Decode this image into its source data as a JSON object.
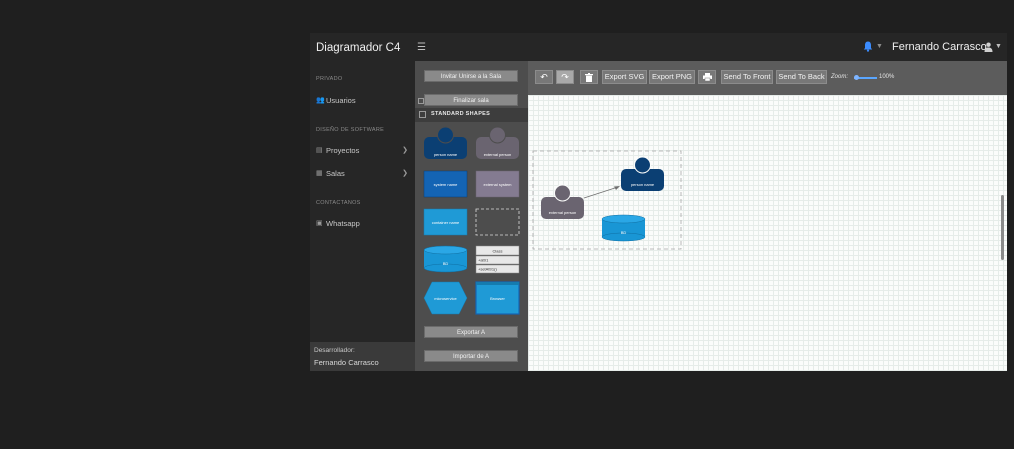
{
  "header": {
    "title": "Diagramador C4",
    "menu_icon": "hamburger-icon",
    "user_name": "Fernando Carrasco",
    "notification_icon": "bell-icon",
    "notification_color": "#3b8cff"
  },
  "sidebar": {
    "sections": [
      {
        "title": "PRIVADO",
        "items": [
          {
            "label": "Usuarios",
            "icon": "users-icon"
          }
        ]
      },
      {
        "title": "DISEÑO DE SOFTWARE",
        "items": [
          {
            "label": "Proyectos",
            "icon": "folder-icon",
            "expandable": true
          },
          {
            "label": "Salas",
            "icon": "rooms-icon",
            "expandable": true
          }
        ]
      },
      {
        "title": "CONTACTANOS",
        "items": [
          {
            "label": "Whatsapp",
            "icon": "whatsapp-icon"
          }
        ]
      }
    ],
    "developer_label": "Desarrollador:",
    "developer_name": "Fernando Carrasco"
  },
  "palette": {
    "invite_button": "Invitar Unirse a la Sala",
    "finish_button": "Finalizar sala",
    "shapes_header": "STANDARD SHAPES",
    "shapes": {
      "person": "person name",
      "external_person": "external person",
      "system": "system name",
      "external_system": "external system",
      "container": "container name",
      "database": "BD",
      "class_title": "Class",
      "class_attr": "+attr1",
      "class_method": "+setAttr1()",
      "microservice": "microservice",
      "browser": "Browser"
    },
    "export_button": "Exportar A",
    "import_button": "Importar de A",
    "colors": {
      "person": "#0b3f73",
      "external": "#6a6470",
      "system": "#1464b4",
      "container": "#1f9ad6",
      "database": "#1996d5"
    }
  },
  "toolbar": {
    "undo_icon": "undo-icon",
    "redo_icon": "redo-icon",
    "delete_icon": "trash-icon",
    "export_svg": "Export SVG",
    "export_png": "Export PNG",
    "print_icon": "print-icon",
    "send_front": "Send To Front",
    "send_back": "Send To Back",
    "zoom_label": "Zoom:",
    "zoom_value": "100%"
  },
  "canvas": {
    "nodes": {
      "external_person": "external person",
      "person": "person name",
      "database": "BD"
    }
  }
}
